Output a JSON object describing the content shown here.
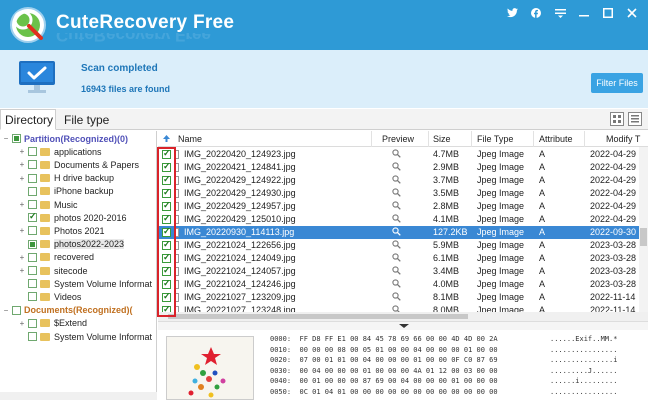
{
  "app": {
    "title": "CuteRecovery Free",
    "window_buttons": [
      "twitter-icon",
      "facebook-icon",
      "menu-icon",
      "minimize-icon",
      "maximize-icon",
      "close-icon"
    ]
  },
  "scan": {
    "title": "Scan completed",
    "subtitle": "16943 files are found",
    "filter_button": "Filter Files"
  },
  "tabs": [
    {
      "label": "Directory",
      "active": true
    },
    {
      "label": "File type",
      "active": false
    }
  ],
  "tree": [
    {
      "label": "Partition(Recognized)(0)",
      "kind": "partition",
      "expand": "−",
      "check": "partial"
    },
    {
      "label": "applications",
      "kind": "folder",
      "expand": "+",
      "check": "none"
    },
    {
      "label": "Documents & Papers",
      "kind": "folder",
      "expand": "+",
      "check": "none"
    },
    {
      "label": "H drive backup",
      "kind": "folder",
      "expand": "+",
      "check": "none"
    },
    {
      "label": "iPhone backup",
      "kind": "folder",
      "expand": "",
      "check": "none"
    },
    {
      "label": "Music",
      "kind": "folder",
      "expand": "+",
      "check": "none"
    },
    {
      "label": "photos 2020-2016",
      "kind": "folder",
      "expand": "",
      "check": "checked"
    },
    {
      "label": "Photos 2021",
      "kind": "folder",
      "expand": "+",
      "check": "none"
    },
    {
      "label": "photos2022-2023",
      "kind": "folder",
      "expand": "",
      "check": "partial",
      "selected": true
    },
    {
      "label": "recovered",
      "kind": "folder",
      "expand": "+",
      "check": "none"
    },
    {
      "label": "sitecode",
      "kind": "folder",
      "expand": "+",
      "check": "none"
    },
    {
      "label": "System Volume Informat",
      "kind": "folder",
      "expand": "",
      "check": "none"
    },
    {
      "label": "Videos",
      "kind": "folder",
      "expand": "",
      "check": "none"
    },
    {
      "label": "Documents(Recognized)(",
      "kind": "partition2",
      "expand": "−",
      "check": "none"
    },
    {
      "label": "$Extend",
      "kind": "folder",
      "expand": "+",
      "check": "none"
    },
    {
      "label": "System Volume Informat",
      "kind": "folder",
      "expand": "",
      "check": "none"
    }
  ],
  "files": {
    "columns": [
      "Name",
      "Preview",
      "Size",
      "File Type",
      "Attribute",
      "Modify T"
    ],
    "rows": [
      {
        "name": "IMG_20220420_124923.jpg",
        "size": "4.7MB",
        "type": "Jpeg Image",
        "attr": "A",
        "modified": "2022-04-29"
      },
      {
        "name": "IMG_20220421_124841.jpg",
        "size": "2.9MB",
        "type": "Jpeg Image",
        "attr": "A",
        "modified": "2022-04-29"
      },
      {
        "name": "IMG_20220429_124922.jpg",
        "size": "3.7MB",
        "type": "Jpeg Image",
        "attr": "A",
        "modified": "2022-04-29"
      },
      {
        "name": "IMG_20220429_124930.jpg",
        "size": "3.5MB",
        "type": "Jpeg Image",
        "attr": "A",
        "modified": "2022-04-29"
      },
      {
        "name": "IMG_20220429_124957.jpg",
        "size": "2.8MB",
        "type": "Jpeg Image",
        "attr": "A",
        "modified": "2022-04-29"
      },
      {
        "name": "IMG_20220429_125010.jpg",
        "size": "4.1MB",
        "type": "Jpeg Image",
        "attr": "A",
        "modified": "2022-04-29"
      },
      {
        "name": "IMG_20220930_114113.jpg",
        "size": "127.2KB",
        "type": "Jpeg Image",
        "attr": "A",
        "modified": "2022-09-30",
        "selected": true
      },
      {
        "name": "IMG_20221024_122656.jpg",
        "size": "5.9MB",
        "type": "Jpeg Image",
        "attr": "A",
        "modified": "2023-03-28"
      },
      {
        "name": "IMG_20221024_124049.jpg",
        "size": "6.1MB",
        "type": "Jpeg Image",
        "attr": "A",
        "modified": "2023-03-28"
      },
      {
        "name": "IMG_20221024_124057.jpg",
        "size": "3.4MB",
        "type": "Jpeg Image",
        "attr": "A",
        "modified": "2023-03-28"
      },
      {
        "name": "IMG_20221024_124246.jpg",
        "size": "4.0MB",
        "type": "Jpeg Image",
        "attr": "A",
        "modified": "2023-03-28"
      },
      {
        "name": "IMG_20221027_123209.jpg",
        "size": "8.1MB",
        "type": "Jpeg Image",
        "attr": "A",
        "modified": "2022-11-14"
      },
      {
        "name": "IMG_20221027_123248.jpg",
        "size": "8.0MB",
        "type": "Jpeg Image",
        "attr": "A",
        "modified": "2022-11-14"
      }
    ]
  },
  "hex": {
    "lines": [
      "0000:  FF D8 FF E1 00 84 45 78 69 66 00 00 4D 4D 00 2A",
      "0010:  00 00 00 08 00 05 01 00 00 04 00 00 00 01 00 00",
      "0020:  07 00 01 01 00 04 00 00 00 01 00 00 0F C0 87 69",
      "0030:  00 04 00 00 00 01 00 00 00 4A 01 12 00 03 00 00",
      "0040:  00 01 00 00 00 87 69 00 04 00 00 00 01 00 00 00",
      "0050:  0C 01 04 01 00 00 00 00 00 00 00 00 00 00 00 00"
    ],
    "ascii": [
      "......Exif..MM.*",
      "................",
      "...............i",
      ".........J......",
      "......i.........",
      "................"
    ]
  },
  "colors": {
    "titlebar": "#2e9ad6",
    "accent": "#3aa3e3",
    "selection": "#3a88d4",
    "highlight_box": "#d9232a"
  }
}
